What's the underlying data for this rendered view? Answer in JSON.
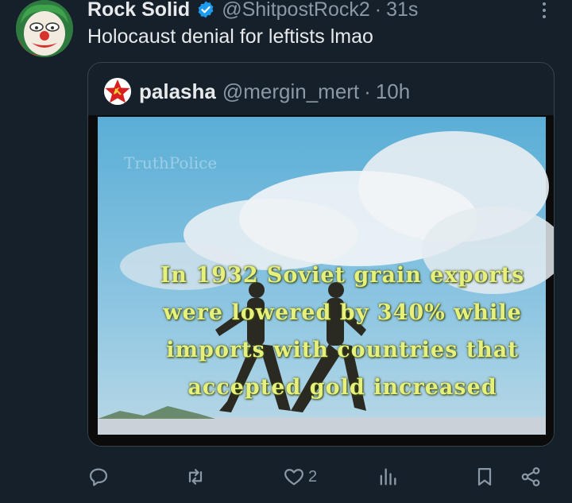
{
  "tweet": {
    "display_name": "Rock Solid",
    "handle": "@ShitpostRock2",
    "separator": "·",
    "time": "31s",
    "text": "Holocaust denial for leftists lmao",
    "verified_icon": "verified-badge-icon",
    "avatar_icon": "clown-avatar"
  },
  "quote": {
    "display_name": "palasha",
    "handle": "@mergin_mert",
    "separator": "·",
    "time": "10h",
    "avatar_icon": "hammer-sickle-star-avatar",
    "media": {
      "watermark": "TruthPolice",
      "caption_lines": [
        "In 1932 Soviet grain exports",
        "were lowered by 340% while",
        "imports with countries that",
        "accepted gold increased"
      ],
      "volume_icon": "volume-muted-icon"
    }
  },
  "actions": {
    "reply": {
      "icon": "reply-icon",
      "count": ""
    },
    "retweet": {
      "icon": "retweet-icon",
      "count": ""
    },
    "like": {
      "icon": "heart-icon",
      "count": "2"
    },
    "views": {
      "icon": "views-icon",
      "count": ""
    },
    "bookmark": {
      "icon": "bookmark-icon",
      "count": ""
    },
    "share": {
      "icon": "share-icon",
      "count": ""
    }
  },
  "colors": {
    "background": "#15202b",
    "primary_text": "#e7e9ea",
    "secondary_text": "#8b98a5",
    "verified": "#1d9bf0",
    "caption": "#e6f07a"
  }
}
